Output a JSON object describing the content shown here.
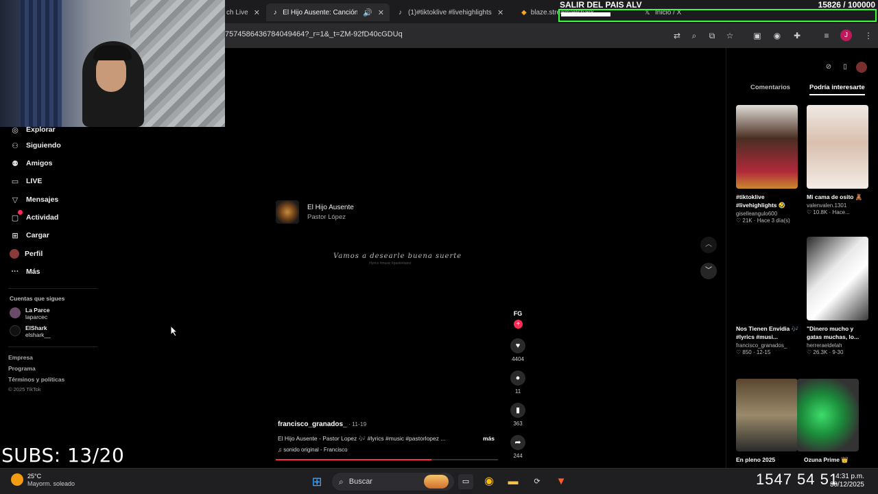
{
  "overlay": {
    "goal_title": "SALIR DEL PAIS ALV",
    "goal_count": "15826 / 100000",
    "goal_progress": 0.158,
    "subs": "SUBS: 13/20"
  },
  "tabs": [
    {
      "label": "ch Live",
      "icon": "tiktok-icon"
    },
    {
      "label": "El Hijo Ausente: Canción",
      "icon": "tiktok-icon",
      "active": true
    },
    {
      "label": "(1)#tiktoklive #livehighlights",
      "icon": "tiktok-icon"
    },
    {
      "label": "blaze.stream/elshark",
      "icon": "brave-icon"
    },
    {
      "label": "Inicio / X",
      "icon": "x-icon"
    }
  ],
  "address": {
    "url": "7574586436784049464?_r=1&_t=ZM-92fD40cGDUq",
    "profile_initial": "J"
  },
  "sidebar": {
    "items": [
      {
        "label": "Explorar",
        "icon": "compass-icon"
      },
      {
        "label": "Siguiendo",
        "icon": "user-check-icon"
      },
      {
        "label": "Amigos",
        "icon": "friends-icon"
      },
      {
        "label": "LIVE",
        "icon": "live-icon"
      },
      {
        "label": "Mensajes",
        "icon": "send-icon"
      },
      {
        "label": "Actividad",
        "icon": "activity-icon"
      },
      {
        "label": "Cargar",
        "icon": "upload-icon"
      },
      {
        "label": "Perfil",
        "icon": "avatar-icon"
      },
      {
        "label": "Más",
        "icon": "more-icon"
      }
    ],
    "following_title": "Cuentas que sigues",
    "following": [
      {
        "name": "La Parce",
        "handle": "laparcec"
      },
      {
        "name": "ElShark",
        "handle": "elshark__"
      }
    ],
    "footer": [
      "Empresa",
      "Programa",
      "Términos y políticas"
    ],
    "copyright": "© 2025 TikTok"
  },
  "video": {
    "song_title": "El Hijo Ausente",
    "song_artist": "Pastor López",
    "lyric": "Vamos a desearle buena suerte",
    "lyric_sub": "#lyrics #music #pastorlopez",
    "creator_initials": "FG",
    "username": "francisco_granados_",
    "date": " · 11-19",
    "description": "El Hijo Ausente - Pastor Lopez 🎶 #lyrics #music #pastorlopez ...",
    "more": "más",
    "sound": "sonido original - Francisco",
    "progress": 0.7,
    "likes": "4404",
    "comments": "11",
    "saves": "363",
    "shares": "244"
  },
  "right_panel": {
    "tab_comments": "Comentarios",
    "tab_suggested": "Podría interesarte",
    "cards": [
      {
        "title": "#tiktoklive #livehighlights 🤣",
        "user": "giselleangulo600",
        "stats": "♡ 21K · Hace 3 día(s)"
      },
      {
        "title": "Mi cama de osito 🧸",
        "user": "valenvalen.1301",
        "stats": "♡ 10.8K · Hace..."
      },
      {
        "title": "Nos Tienen Envidia 🎶 #lyrics #musi...",
        "user": "francisco_granados_",
        "stats": "♡ 850 · 12-15"
      },
      {
        "title": "\"Dinero mucho y gatas muchas, lo...",
        "user": "herreraeldelah",
        "stats": "♡ 26.3K · 9-30"
      },
      {
        "title": "En pleno 2025",
        "user": "",
        "stats": ""
      },
      {
        "title": "Ozuna Prime 👑",
        "user": "",
        "stats": ""
      }
    ]
  },
  "taskbar": {
    "temp": "25°C",
    "weather": "Mayorm. soleado",
    "search": "Buscar",
    "time": "4:31 p.m.",
    "date": "30/12/2025",
    "timer": "1547 54 51"
  }
}
